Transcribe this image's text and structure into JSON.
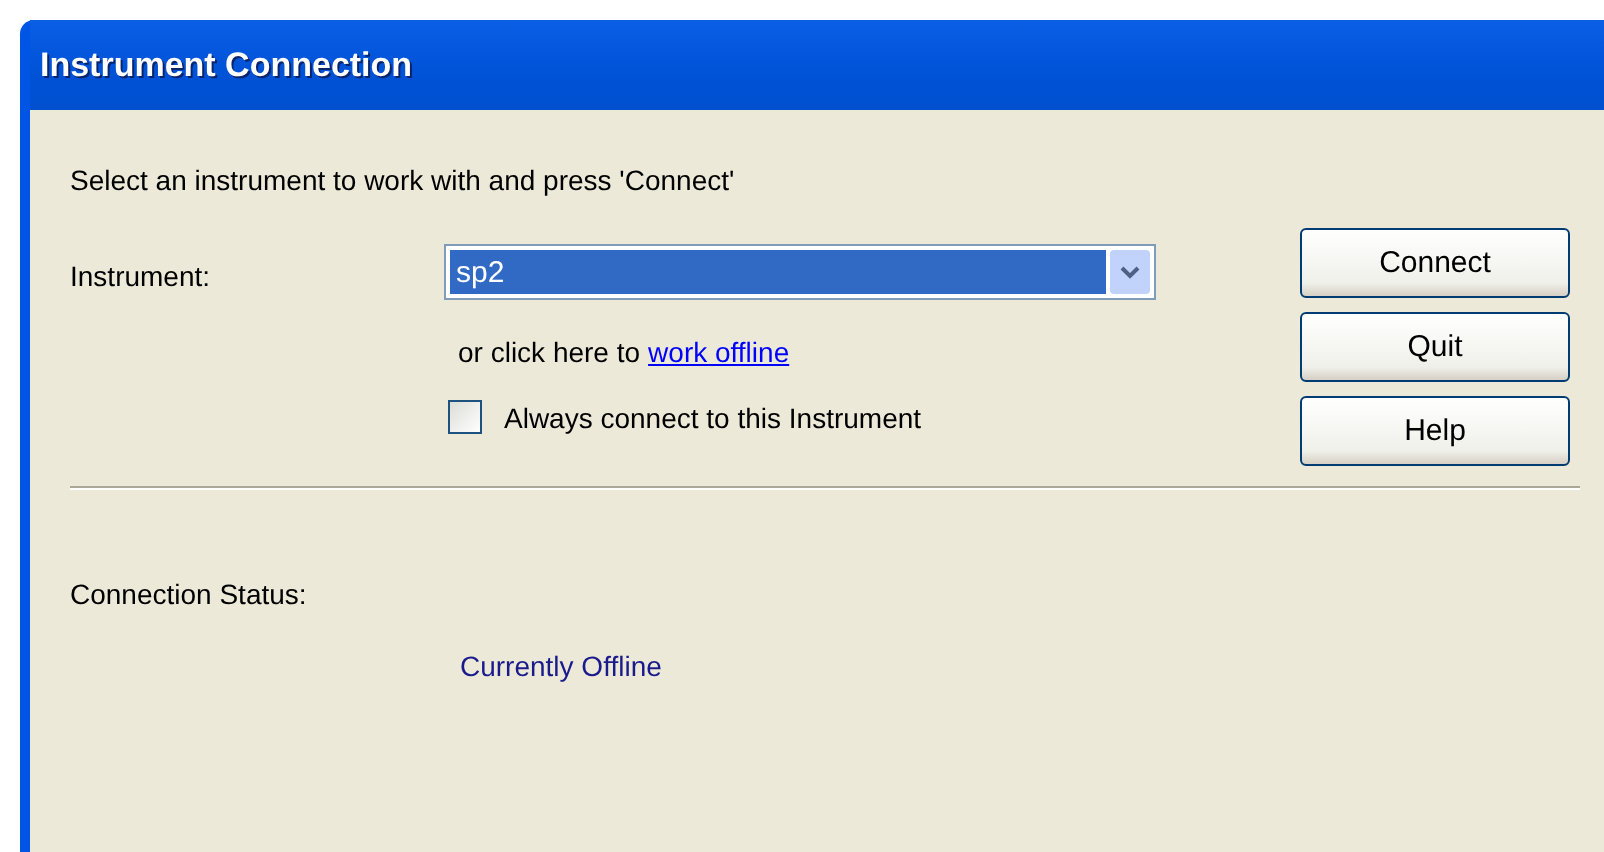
{
  "window": {
    "title": "Instrument Connection"
  },
  "prompt": "Select an instrument to work with and press 'Connect'",
  "instrument": {
    "label": "Instrument:",
    "value": "sp2",
    "selected": true
  },
  "offline": {
    "text": "or click here to",
    "link": "work offline"
  },
  "always_connect": {
    "label": "Always connect to this Instrument",
    "checked": false
  },
  "buttons": [
    "Connect",
    "Quit",
    "Help"
  ],
  "status": {
    "label": "Connection Status:",
    "value": "Currently Offline"
  }
}
